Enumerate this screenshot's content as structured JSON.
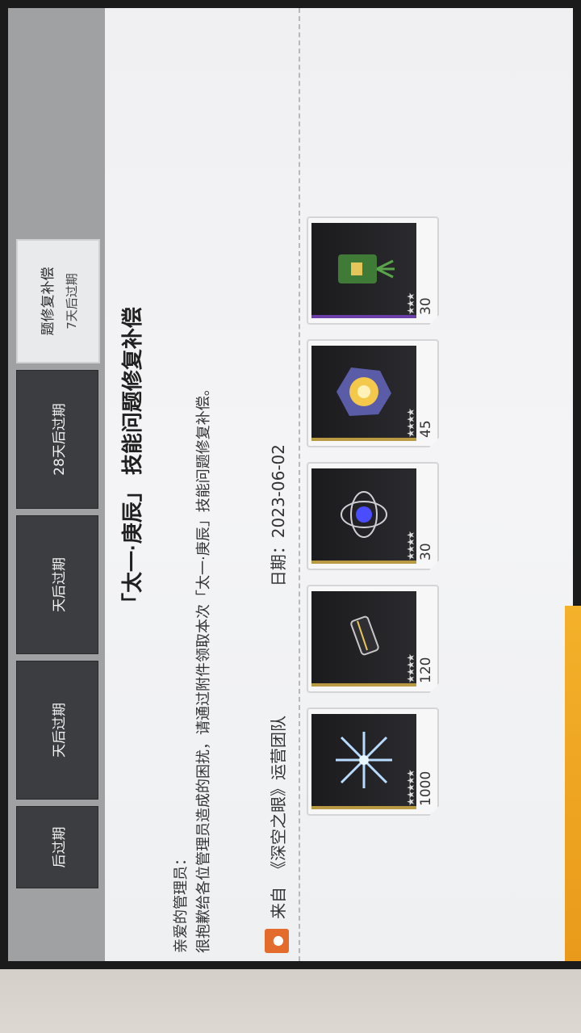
{
  "topbar": {
    "cards": [
      {
        "label": "后过期"
      },
      {
        "label": "天后过期"
      },
      {
        "label": "天后过期"
      },
      {
        "label": "28天后过期"
      }
    ],
    "active_card": {
      "title": "题修复补偿",
      "sub": "7天后过期"
    }
  },
  "mail": {
    "title": "「太一·庚辰」 技能问题修复补偿",
    "greeting": "亲爱的管理员：",
    "body": "很抱歉给各位管理员造成的困扰，请通过附件领取本次「太一·庚辰」技能问题修复补偿。",
    "sender_label": "来自",
    "sender": "《深空之眼》运营团队",
    "date": "日期：2023-06-02"
  },
  "rewards": [
    {
      "count": "1000",
      "stars": "★★★★★",
      "icon": "crystal-shard-icon"
    },
    {
      "count": "120",
      "stars": "★★★★",
      "icon": "sealed-vial-icon"
    },
    {
      "count": "30",
      "stars": "★★★★",
      "icon": "orb-core-icon"
    },
    {
      "count": "45",
      "stars": "★★★★",
      "icon": "golden-fragment-icon"
    },
    {
      "count": "30",
      "stars": "★★★",
      "icon": "jade-token-icon"
    }
  ],
  "colors": {
    "accent": "#e36b2b",
    "gold": "#b99a43",
    "purple": "#6b3fa8",
    "claim": "#f4b12a"
  }
}
